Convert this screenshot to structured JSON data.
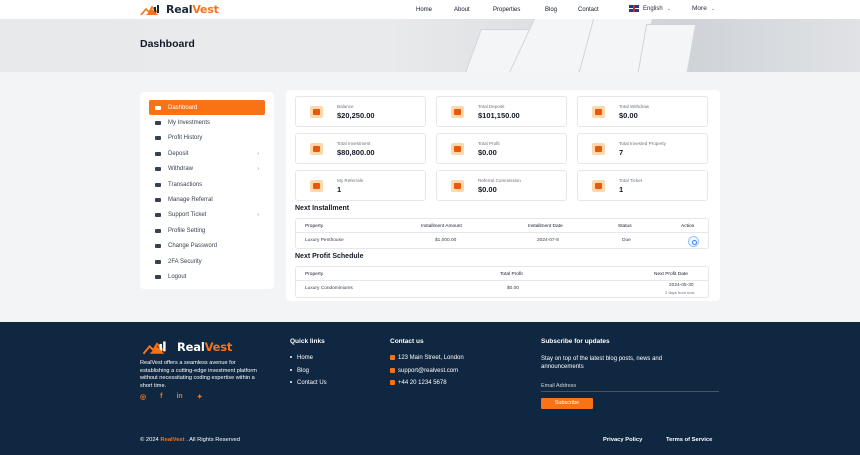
{
  "brand": {
    "name_primary": "Real",
    "name_accent": "Vest"
  },
  "nav": {
    "links": [
      "Home",
      "About",
      "Properties",
      "Blog",
      "Contact"
    ],
    "language": "English",
    "more": "More"
  },
  "hero": {
    "title": "Dashboard"
  },
  "sidebar": {
    "items": [
      {
        "label": "Dashboard",
        "icon": "grid-icon",
        "active": true
      },
      {
        "label": "My Investments",
        "icon": "chart-icon"
      },
      {
        "label": "Profit History",
        "icon": "coins-icon"
      },
      {
        "label": "Deposit",
        "icon": "wallet-icon",
        "has_children": true
      },
      {
        "label": "Withdraw",
        "icon": "bank-icon",
        "has_children": true
      },
      {
        "label": "Transactions",
        "icon": "exchange-icon"
      },
      {
        "label": "Manage Referral",
        "icon": "users-icon"
      },
      {
        "label": "Support Ticket",
        "icon": "ticket-icon",
        "has_children": true
      },
      {
        "label": "Profile Setting",
        "icon": "user-cog-icon"
      },
      {
        "label": "Change Password",
        "icon": "lock-icon"
      },
      {
        "label": "2FA Security",
        "icon": "shield-icon"
      },
      {
        "label": "Logout",
        "icon": "logout-icon"
      }
    ]
  },
  "stats": [
    {
      "label": "Balance",
      "value": "$20,250.00"
    },
    {
      "label": "Total Deposit",
      "value": "$101,150.00"
    },
    {
      "label": "Total Withdraw",
      "value": "$0.00"
    },
    {
      "label": "Total Investment",
      "value": "$80,800.00"
    },
    {
      "label": "Total Profit",
      "value": "$0.00"
    },
    {
      "label": "Total Invested Property",
      "value": "7"
    },
    {
      "label": "My Referrals",
      "value": "1"
    },
    {
      "label": "Referral Commission",
      "value": "$0.00"
    },
    {
      "label": "Total Ticket",
      "value": "1"
    }
  ],
  "next_installment": {
    "title": "Next Installment",
    "headers": [
      "Property",
      "Installment Amount",
      "Installment Date",
      "Status",
      "Action"
    ],
    "rows": [
      {
        "property": "Luxury Penthouse",
        "amount": "$1,000.00",
        "date": "2024-07-8",
        "status": "Due"
      }
    ]
  },
  "next_profit": {
    "title": "Next Profit Schedule",
    "headers": [
      "Property",
      "Total Profit",
      "Next Profit Date"
    ],
    "rows": [
      {
        "property": "Luxury Condominiums",
        "profit": "$0.00",
        "date": "2024-05-30",
        "relative": "2 days from now"
      }
    ]
  },
  "footer": {
    "description": "RealVest offers a seamless avenue for establishing a cutting-edge investment platform without necessitating coding expertise within a short time.",
    "socials": [
      "instagram-icon",
      "facebook-icon",
      "linkedin-icon",
      "twitter-icon"
    ],
    "quick_links_title": "Quick links",
    "quick_links": [
      "Home",
      "Blog",
      "Contact Us"
    ],
    "contact_title": "Contact us",
    "contact": {
      "address": "123 Main Street, London",
      "email": "support@realvest.com",
      "phone": "+44 20 1234 5678"
    },
    "subscribe_title": "Subscribe for updates",
    "subscribe_text": "Stay on top of the latest blog posts, news and announcements",
    "email_placeholder": "Email Address",
    "subscribe_button": "Subscribe",
    "copyright_prefix": "© 2024",
    "copyright_brand": "RealVest",
    "copyright_suffix": ". All Rights Reserved",
    "privacy": "Privacy Policy",
    "terms": "Terms of Service"
  },
  "colors": {
    "accent": "#f97316",
    "footer_bg": "#0f2740"
  }
}
